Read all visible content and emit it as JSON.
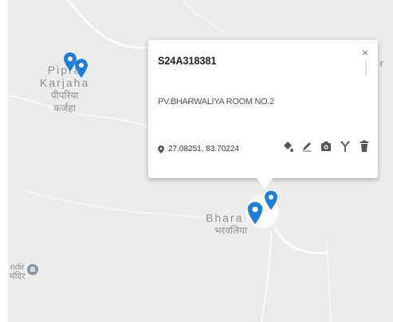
{
  "map": {
    "places": {
      "pipra": {
        "line1": "Pipra",
        "line2": "Karjaha",
        "line3": "पीपरिया",
        "line4": "कर्जहा"
      },
      "bharawaliya": {
        "line1": "Bhara   a",
        "line2": "भरवलिया"
      },
      "nar": {
        "line1": "Nar"
      },
      "mandir": {
        "line1": "ndir",
        "line2": "मंदिर"
      }
    },
    "pin_color": "#1e7ed3"
  },
  "popup": {
    "title": "S24A318381",
    "close_label": "×",
    "address": "PV.BHARWALIYA ROOM NO.2",
    "coordinates": "27.08251, 83.70224",
    "icons": [
      "fill-icon",
      "edit-icon",
      "camera-icon",
      "route-icon",
      "delete-icon"
    ]
  }
}
